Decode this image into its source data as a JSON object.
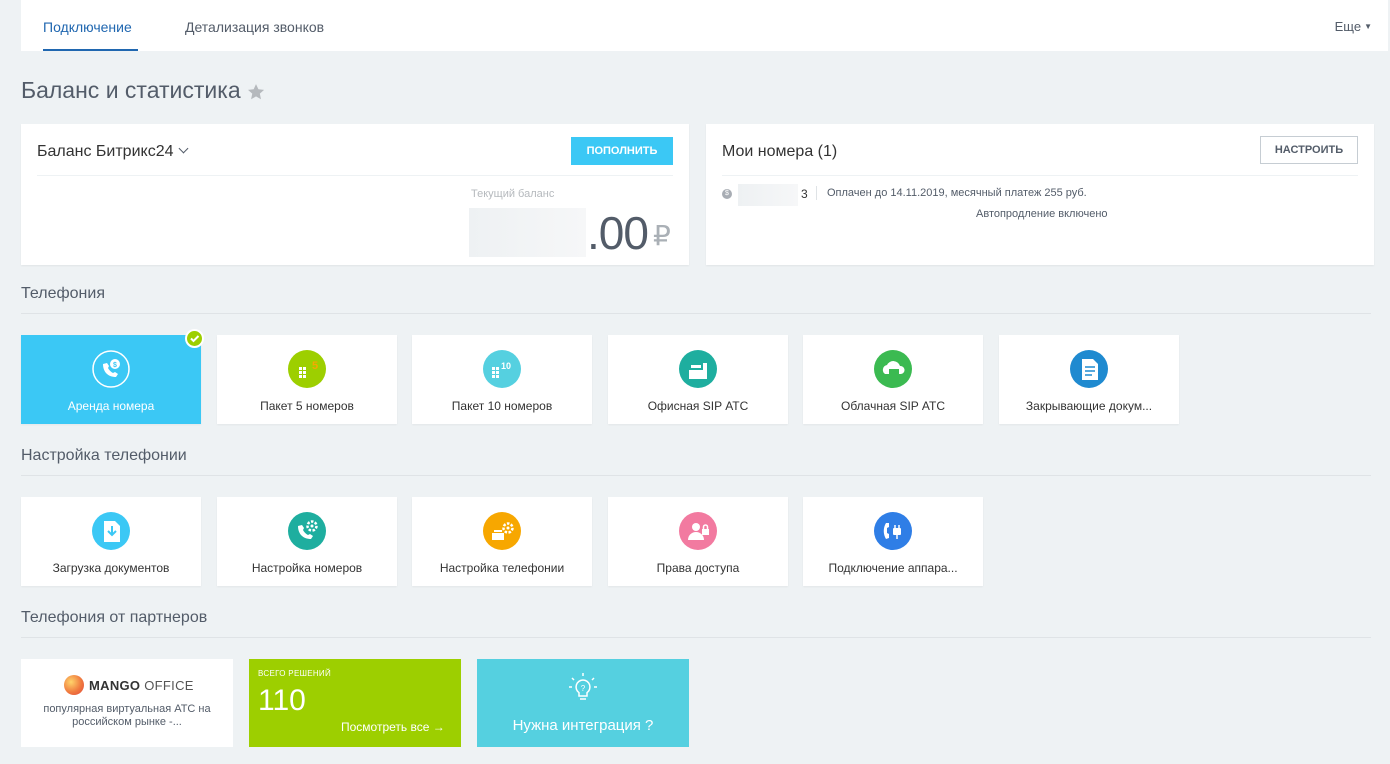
{
  "nav": {
    "tabs": [
      {
        "label": "Подключение",
        "active": true
      },
      {
        "label": "Детализация звонков",
        "active": false
      }
    ],
    "more_label": "Еще",
    "accent_color": "#2067b0"
  },
  "page": {
    "title": "Баланс и статистика",
    "favorite_icon": "star-icon"
  },
  "balance": {
    "title": "Баланс Битрикс24",
    "topup_label": "пополнить",
    "current_label": "Текущий баланс",
    "amount": ".00",
    "currency": "₽"
  },
  "numbers": {
    "title": "Мои номера (1)",
    "setup_label": "настроить",
    "coin": "$",
    "number_suffix": "3",
    "paid_text": "Оплачен до 14.11.2019, месячный платеж 255 руб.",
    "autorenew_text": "Автопродление включено"
  },
  "telephony": {
    "title": "Телефония",
    "tiles": [
      {
        "label": "Аренда номера",
        "icon": "phone-dollar-icon",
        "color": "#3bc8f5",
        "active": true
      },
      {
        "label": "Пакет 5 номеров",
        "icon": "package-5-icon",
        "color": "#9dcf00",
        "active": false
      },
      {
        "label": "Пакет 10 номеров",
        "icon": "package-10-icon",
        "color": "#55d0e0",
        "active": false
      },
      {
        "label": "Офисная SIP АТС",
        "icon": "office-sip-icon",
        "color": "#1eae9f",
        "active": false
      },
      {
        "label": "Облачная SIP АТС",
        "icon": "cloud-sip-icon",
        "color": "#3bba51",
        "active": false
      },
      {
        "label": "Закрывающие докум...",
        "icon": "document-icon",
        "color": "#1f8ad0",
        "active": false
      }
    ]
  },
  "settings": {
    "title": "Настройка телефонии",
    "tiles": [
      {
        "label": "Загрузка документов",
        "icon": "upload-document-icon",
        "color": "#3bc8f5"
      },
      {
        "label": "Настройка номеров",
        "icon": "phone-gear-icon",
        "color": "#1eae9f"
      },
      {
        "label": "Настройка телефонии",
        "icon": "telephony-gear-icon",
        "color": "#f7a700"
      },
      {
        "label": "Права доступа",
        "icon": "user-lock-icon",
        "color": "#f27aa0"
      },
      {
        "label": "Подключение аппара...",
        "icon": "phone-plug-icon",
        "color": "#2f7ee6"
      }
    ]
  },
  "partners": {
    "title": "Телефония от партнеров",
    "mango": {
      "name_bold": "MANGO",
      "name_light": "OFFICE",
      "desc": "популярная виртуальная АТС на российском рынке -..."
    },
    "solutions": {
      "caption": "всего решений",
      "count": "110",
      "link": "Посмотреть все →"
    },
    "integration": {
      "label": "Нужна интеграция ?"
    }
  }
}
